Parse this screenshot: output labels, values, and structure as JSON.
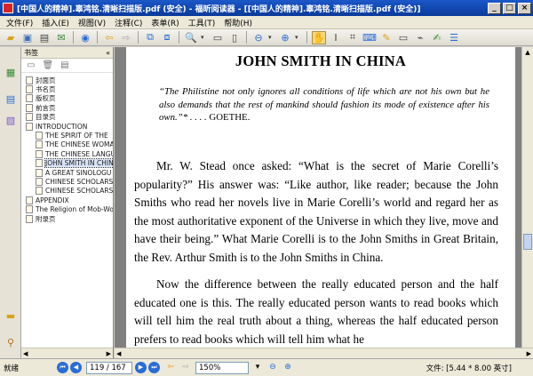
{
  "window": {
    "title": "[中国人的精神].辜鸿铭.清晰扫描版.pdf (安全) - 福昕阅读器 - [[中国人的精神].辜鸿铭.清晰扫描版.pdf (安全)]",
    "min_glyph": "_",
    "max_glyph": "□",
    "close_glyph": "×"
  },
  "menu": [
    "文件(F)",
    "插入(E)",
    "视图(V)",
    "注释(C)",
    "表单(R)",
    "工具(T)",
    "帮助(H)"
  ],
  "toolbar": {
    "icons": [
      "open-icon",
      "save-icon",
      "print-icon",
      "email-icon",
      "first-page-icon",
      "back-icon",
      "forward-icon",
      "page-layout-icon",
      "extract-icon",
      "zoom-in-icon",
      "zoom-out-icon",
      "zoom-plus-icon",
      "hand-icon",
      "select-text-icon",
      "snapshot-icon",
      "typewriter-icon",
      "note-icon",
      "highlight-icon",
      "fit-page-icon"
    ]
  },
  "bookmarks": {
    "header": "书签",
    "collapse_glyph": "«",
    "items": [
      {
        "label": "封面页",
        "level": 0
      },
      {
        "label": "书名页",
        "level": 0
      },
      {
        "label": "版权页",
        "level": 0
      },
      {
        "label": "前言页",
        "level": 0
      },
      {
        "label": "目录页",
        "level": 0
      },
      {
        "label": "INTRODUCTION",
        "level": 0,
        "expanded": true
      },
      {
        "label": "THE SPIRIT OF THE",
        "level": 1
      },
      {
        "label": "THE CHINESE WOMA",
        "level": 1
      },
      {
        "label": "THE CHINESE LANGU",
        "level": 1
      },
      {
        "label": "JOHN SMITH IN CHIN",
        "level": 1,
        "selected": true
      },
      {
        "label": "A GREAT SINOLOGU",
        "level": 1
      },
      {
        "label": "CHINESE SCHOLARSI",
        "level": 1
      },
      {
        "label": "CHINESE SCHOLARSI",
        "level": 1
      },
      {
        "label": "APPENDIX",
        "level": 0
      },
      {
        "label": "The Religion of Mob-Wo",
        "level": 0
      },
      {
        "label": "附录页",
        "level": 0
      }
    ]
  },
  "document": {
    "heading": "JOHN SMITH IN CHINA",
    "epigraph": "“The Philistine not only ignores all conditions of life which are not his own but he also demands that the rest of mankind should fashion its mode of existence after his own.”* . . . .",
    "epigraph_source": "GOETHE.",
    "paragraph1": "Mr. W. Stead once asked: “What is the secret of Marie Corelli’s popularity?” His answer was: “Like author, like reader; because the John Smiths who read her novels live in Marie Corelli’s world and regard her as the most authoritative exponent of the Universe in which they live, move and have their being.” What Marie Corelli is to the John Smiths in Great Britain, the Rev. Arthur Smith is to the John Smiths in China.",
    "paragraph2": "Now the difference between the really educated person and the half educated one is this. The really educated person wants to read books which will tell him the real truth about a thing, whereas the half educated person prefers to read books which will tell him what he"
  },
  "status": {
    "ready": "就绪",
    "page_display": "119 / 167",
    "zoom": "150%",
    "doc_size": "文件: [5.44 * 8.00 英寸]"
  }
}
